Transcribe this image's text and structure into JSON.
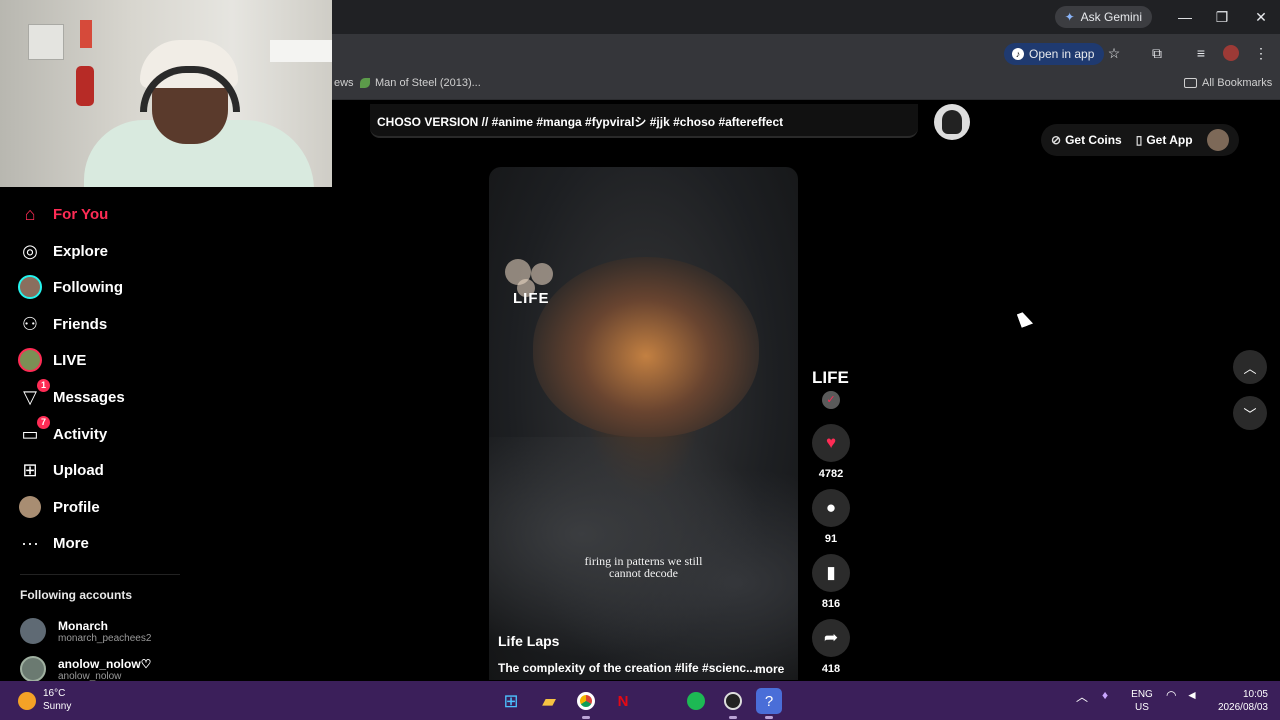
{
  "browser": {
    "gemini_label": "Ask Gemini",
    "open_in_app": "Open in app",
    "bookmark_partial": "ews",
    "bookmark_item": "Man of Steel (2013)...",
    "all_bookmarks": "All Bookmarks"
  },
  "sidebar": {
    "items": [
      {
        "label": "For You",
        "icon": "home-icon"
      },
      {
        "label": "Explore",
        "icon": "compass-icon"
      },
      {
        "label": "Following",
        "icon": "avatar"
      },
      {
        "label": "Friends",
        "icon": "friends-icon"
      },
      {
        "label": "LIVE",
        "icon": "avatar-live"
      },
      {
        "label": "Messages",
        "icon": "send-icon",
        "badge": "1"
      },
      {
        "label": "Activity",
        "icon": "inbox-icon",
        "badge": "7"
      },
      {
        "label": "Upload",
        "icon": "plus-square-icon"
      },
      {
        "label": "Profile",
        "icon": "avatar"
      },
      {
        "label": "More",
        "icon": "ellipsis-icon"
      }
    ],
    "following_title": "Following accounts",
    "following": [
      {
        "name": "Monarch",
        "handle": "monarch_peachees2"
      },
      {
        "name": "anolow_nolow♡",
        "handle": "anolow_nolow"
      }
    ]
  },
  "feed": {
    "prev_caption": "CHOSO VERSION // #anime #manga #fypviralシ #jjk #choso #aftereffect",
    "get_coins": "Get Coins",
    "get_app": "Get App",
    "video": {
      "logo": "LIFE",
      "subtitle_1": "firing in patterns we still",
      "subtitle_2": "cannot decode",
      "author": "Life Laps",
      "description": "The complexity of the creation #life #scienc...",
      "more": "more"
    },
    "rail": {
      "avatar_text": "LIFE",
      "likes": "4782",
      "comments": "91",
      "saves": "816",
      "shares": "418"
    }
  },
  "taskbar": {
    "temp": "16°C",
    "weather": "Sunny",
    "lang_1": "ENG",
    "lang_2": "US",
    "time": "10:05",
    "date": "2026/08/03"
  }
}
